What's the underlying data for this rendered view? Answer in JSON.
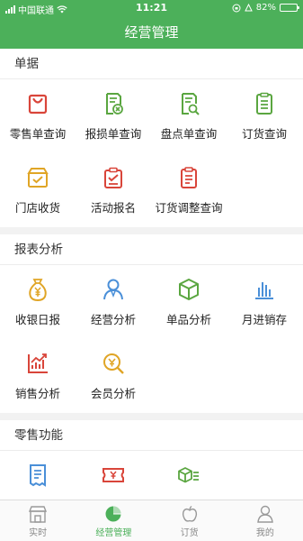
{
  "status_bar": {
    "carrier": "中国联通",
    "time": "11:21",
    "battery_percent": "82%",
    "battery_level": 0.82
  },
  "header": {
    "title": "经营管理"
  },
  "sections": [
    {
      "title": "单据",
      "items": [
        {
          "label": "零售单查询",
          "icon": "shopping-bag-icon"
        },
        {
          "label": "报损单查询",
          "icon": "loss-report-icon"
        },
        {
          "label": "盘点单查询",
          "icon": "inventory-search-icon"
        },
        {
          "label": "订货查询",
          "icon": "order-list-icon"
        },
        {
          "label": "门店收货",
          "icon": "store-receive-icon"
        },
        {
          "label": "活动报名",
          "icon": "event-signup-icon"
        },
        {
          "label": "订货调整查询",
          "icon": "order-adjust-icon"
        }
      ]
    },
    {
      "title": "报表分析",
      "items": [
        {
          "label": "收银日报",
          "icon": "money-bag-icon"
        },
        {
          "label": "经营分析",
          "icon": "person-icon"
        },
        {
          "label": "单品分析",
          "icon": "box-icon"
        },
        {
          "label": "月进销存",
          "icon": "bar-chart-icon"
        },
        {
          "label": "销售分析",
          "icon": "trend-chart-icon"
        },
        {
          "label": "会员分析",
          "icon": "member-search-icon"
        }
      ]
    },
    {
      "title": "零售功能",
      "items": [
        {
          "label": "",
          "icon": "receipt-icon"
        },
        {
          "label": "",
          "icon": "ticket-icon"
        },
        {
          "label": "",
          "icon": "box-list-icon"
        }
      ]
    }
  ],
  "tabbar": {
    "items": [
      {
        "label": "实时",
        "icon": "store-icon",
        "active": false
      },
      {
        "label": "经营管理",
        "icon": "pie-chart-icon",
        "active": true
      },
      {
        "label": "订货",
        "icon": "apple-icon",
        "active": false
      },
      {
        "label": "我的",
        "icon": "user-icon",
        "active": false
      }
    ]
  },
  "colors": {
    "brand_green": "#4cb05a",
    "icon_red": "#d9453a",
    "icon_gold": "#e0a526",
    "icon_blue": "#4a8fd8",
    "icon_green": "#5aa640"
  }
}
